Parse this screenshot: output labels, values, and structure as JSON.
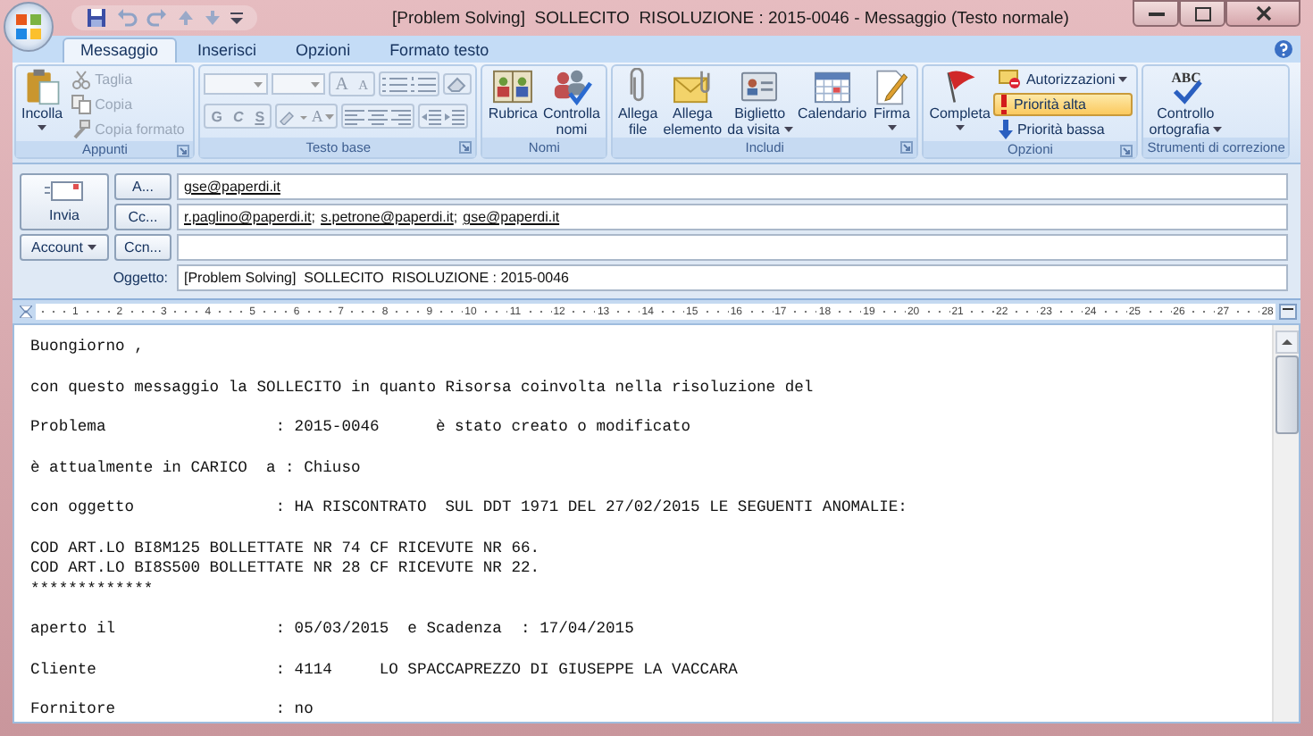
{
  "window": {
    "title": "[Problem Solving]  SOLLECITO  RISOLUZIONE : 2015-0046 - Messaggio (Testo normale)"
  },
  "tabs": [
    {
      "label": "Messaggio",
      "selected": true
    },
    {
      "label": "Inserisci",
      "selected": false
    },
    {
      "label": "Opzioni",
      "selected": false
    },
    {
      "label": "Formato testo",
      "selected": false
    }
  ],
  "ribbon": {
    "groups": [
      {
        "label": "Appunti",
        "launcher": true,
        "items": [
          {
            "kind": "large",
            "label": "Incolla",
            "dropdown": true,
            "disabled": false
          },
          {
            "kind": "stack",
            "buttons": [
              {
                "label": "Taglia",
                "disabled": true,
                "selected": false,
                "dropdown": false
              },
              {
                "label": "Copia",
                "disabled": true,
                "selected": false,
                "dropdown": false
              },
              {
                "label": "Copia formato",
                "disabled": true,
                "selected": false,
                "dropdown": false
              }
            ]
          }
        ]
      },
      {
        "label": "Testo base",
        "launcher": true,
        "items": [
          {
            "kind": "format",
            "disabled": true,
            "grow_shrink": [
              "A",
              "A"
            ],
            "styles": [
              "G",
              "C",
              "S"
            ],
            "font_color": "A"
          }
        ]
      },
      {
        "label": "Nomi",
        "launcher": false,
        "items": [
          {
            "kind": "large",
            "label": "Rubrica",
            "dropdown": false,
            "disabled": false
          },
          {
            "kind": "large",
            "label": "Controlla\nnomi",
            "dropdown": false,
            "disabled": false
          }
        ]
      },
      {
        "label": "Includi",
        "launcher": true,
        "items": [
          {
            "kind": "large",
            "label": "Allega\nfile",
            "dropdown": false,
            "disabled": false
          },
          {
            "kind": "large",
            "label": "Allega\nelemento",
            "dropdown": false,
            "disabled": false
          },
          {
            "kind": "large",
            "label": "Biglietto\nda visita",
            "dropdown": true,
            "disabled": false
          },
          {
            "kind": "large",
            "label": "Calendario",
            "dropdown": false,
            "disabled": false
          },
          {
            "kind": "large",
            "label": "Firma",
            "dropdown": true,
            "disabled": false
          }
        ]
      },
      {
        "label": "Opzioni",
        "launcher": true,
        "items": [
          {
            "kind": "large",
            "label": "Completa",
            "dropdown": true,
            "disabled": false
          },
          {
            "kind": "stack",
            "buttons": [
              {
                "label": "Autorizzazioni",
                "disabled": false,
                "selected": false,
                "dropdown": true
              },
              {
                "label": "Priorità alta",
                "disabled": false,
                "selected": true,
                "dropdown": false
              },
              {
                "label": "Priorità bassa",
                "disabled": false,
                "selected": false,
                "dropdown": false
              }
            ]
          }
        ]
      },
      {
        "label": "Strumenti di correzione",
        "launcher": false,
        "items": [
          {
            "kind": "large",
            "label": "Controllo\nortografia",
            "dropdown": true,
            "disabled": false,
            "icon_text": "ABC"
          }
        ]
      }
    ]
  },
  "compose": {
    "send": "Invia",
    "account": "Account",
    "fields": [
      {
        "kind": "recipients",
        "button": "A...",
        "recipients": [
          {
            "address": "gse@paperdi.it"
          }
        ]
      },
      {
        "kind": "recipients",
        "button": "Cc...",
        "recipients": [
          {
            "address": "r.paglino@paperdi.it",
            "separator": ";"
          },
          {
            "address": "s.petrone@paperdi.it",
            "separator": ";"
          },
          {
            "address": "gse@paperdi.it"
          }
        ]
      },
      {
        "kind": "recipients",
        "button": "Ccn..."
      },
      {
        "kind": "subject",
        "label": "Oggetto:",
        "value": "[Problem Solving]  SOLLECITO  RISOLUZIONE : 2015-0046"
      }
    ]
  },
  "ruler": {
    "numbers": [
      "1",
      "2",
      "3",
      "4",
      "5",
      "6",
      "7",
      "8",
      "9",
      "10",
      "11",
      "12",
      "13",
      "14",
      "15",
      "16",
      "17",
      "18",
      "19",
      "20",
      "21",
      "22",
      "23",
      "24",
      "25",
      "26",
      "27",
      "28"
    ]
  },
  "body": {
    "paragraphs": [
      [
        "Buongiorno ,"
      ],
      [
        "con questo messaggio la SOLLECITO in quanto Risorsa coinvolta nella risoluzione del"
      ],
      [
        "Problema                  : 2015-0046      è stato creato o modificato"
      ],
      [
        "è attualmente in CARICO  a : Chiuso"
      ],
      [
        "con oggetto               : HA RISCONTRATO  SUL DDT 1971 DEL 27/02/2015 LE SEGUENTI ANOMALIE:"
      ],
      [
        "COD ART.LO BI8M125 BOLLETTATE NR 74 CF RICEVUTE NR 66.",
        "COD ART.LO BI8S500 BOLLETTATE NR 28 CF RICEVUTE NR 22.",
        "*************"
      ],
      [
        "aperto il                 : 05/03/2015  e Scadenza  : 17/04/2015"
      ],
      [
        "Cliente                   : 4114     LO SPACCAPREZZO DI GIUSEPPE LA VACCARA"
      ],
      [
        "Fornitore                 : no"
      ]
    ]
  }
}
